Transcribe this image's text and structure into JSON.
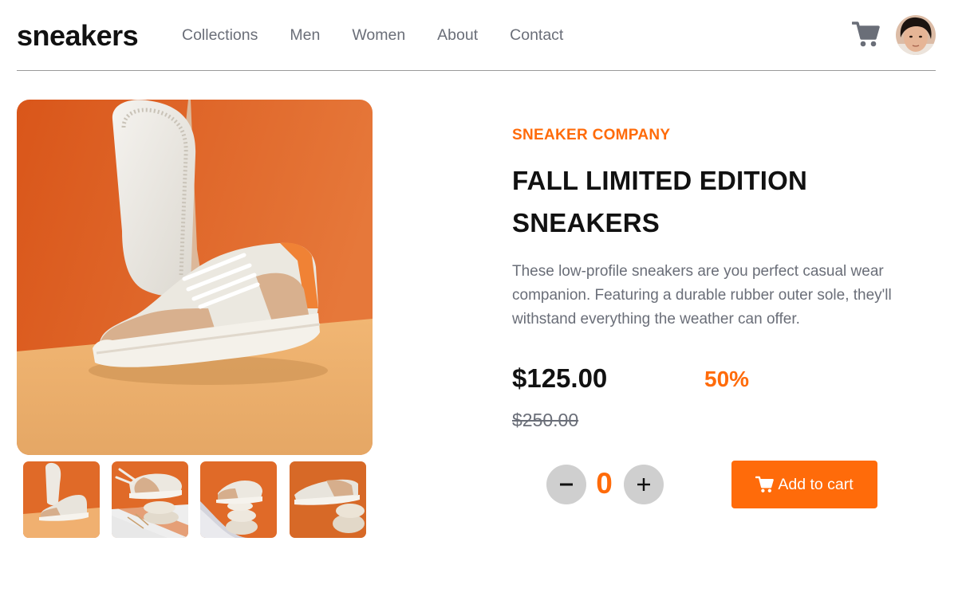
{
  "header": {
    "logo": "sneakers",
    "nav": [
      "Collections",
      "Men",
      "Women",
      "About",
      "Contact"
    ],
    "cart_icon": "cart-icon",
    "avatar_icon": "user-avatar"
  },
  "gallery": {
    "main_image": "sneaker-product-photo",
    "thumbnails": [
      "thumbnail-1",
      "thumbnail-2",
      "thumbnail-3",
      "thumbnail-4"
    ]
  },
  "product": {
    "company": "SNEAKER COMPANY",
    "title": "FALL LIMITED EDITION SNEAKERS",
    "description": "These low-profile sneakers are you perfect casual wear companion. Featuring a durable rubber outer sole, they'll withstand everything the weather can offer.",
    "price": "$125.00",
    "discount": "50%",
    "original_price": "$250.00"
  },
  "cart_controls": {
    "minus_icon": "minus-icon",
    "quantity": "0",
    "plus_icon": "plus-icon",
    "add_to_cart": "Add to cart"
  },
  "colors": {
    "accent": "#ff6b0a",
    "text_dark": "#111111",
    "text_muted": "#6a6e78",
    "qty_button_bg": "#cfcfcf"
  }
}
